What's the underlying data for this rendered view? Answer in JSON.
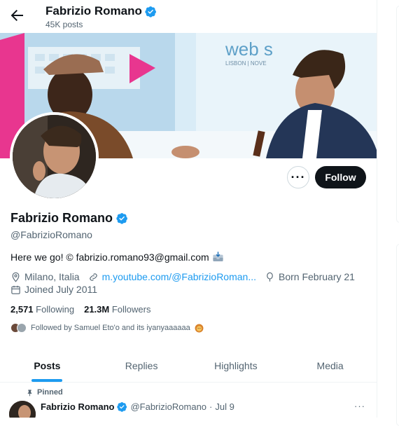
{
  "header": {
    "name": "Fabrizio Romano",
    "posts": "45K posts"
  },
  "banner": {
    "sign_text": "web s",
    "sign_sub": "LISBON | NOVE"
  },
  "profile": {
    "name": "Fabrizio Romano",
    "handle": "@FabrizioRomano",
    "bio": "Here we go! © fabrizio.romano93@gmail.com",
    "location": "Milano, Italia",
    "link": "m.youtube.com/@FabrizioRoman...",
    "born": "Born February 21",
    "joined": "Joined July 2011",
    "following_count": "2,571",
    "following_label": "Following",
    "followers_count": "21.3M",
    "followers_label": "Followers",
    "followed_by": "Followed by Samuel Eto'o and its iyanyaaaaaa"
  },
  "actions": {
    "more": "···",
    "follow": "Follow"
  },
  "tabs": [
    "Posts",
    "Replies",
    "Highlights",
    "Media"
  ],
  "pinned": {
    "label": "Pinned",
    "name": "Fabrizio Romano",
    "handle": "@FabrizioRomano",
    "sep": "·",
    "date": "Jul 9",
    "more": "···"
  },
  "colors": {
    "accent": "#1d9bf0",
    "text": "#0f1419",
    "muted": "#536471"
  }
}
